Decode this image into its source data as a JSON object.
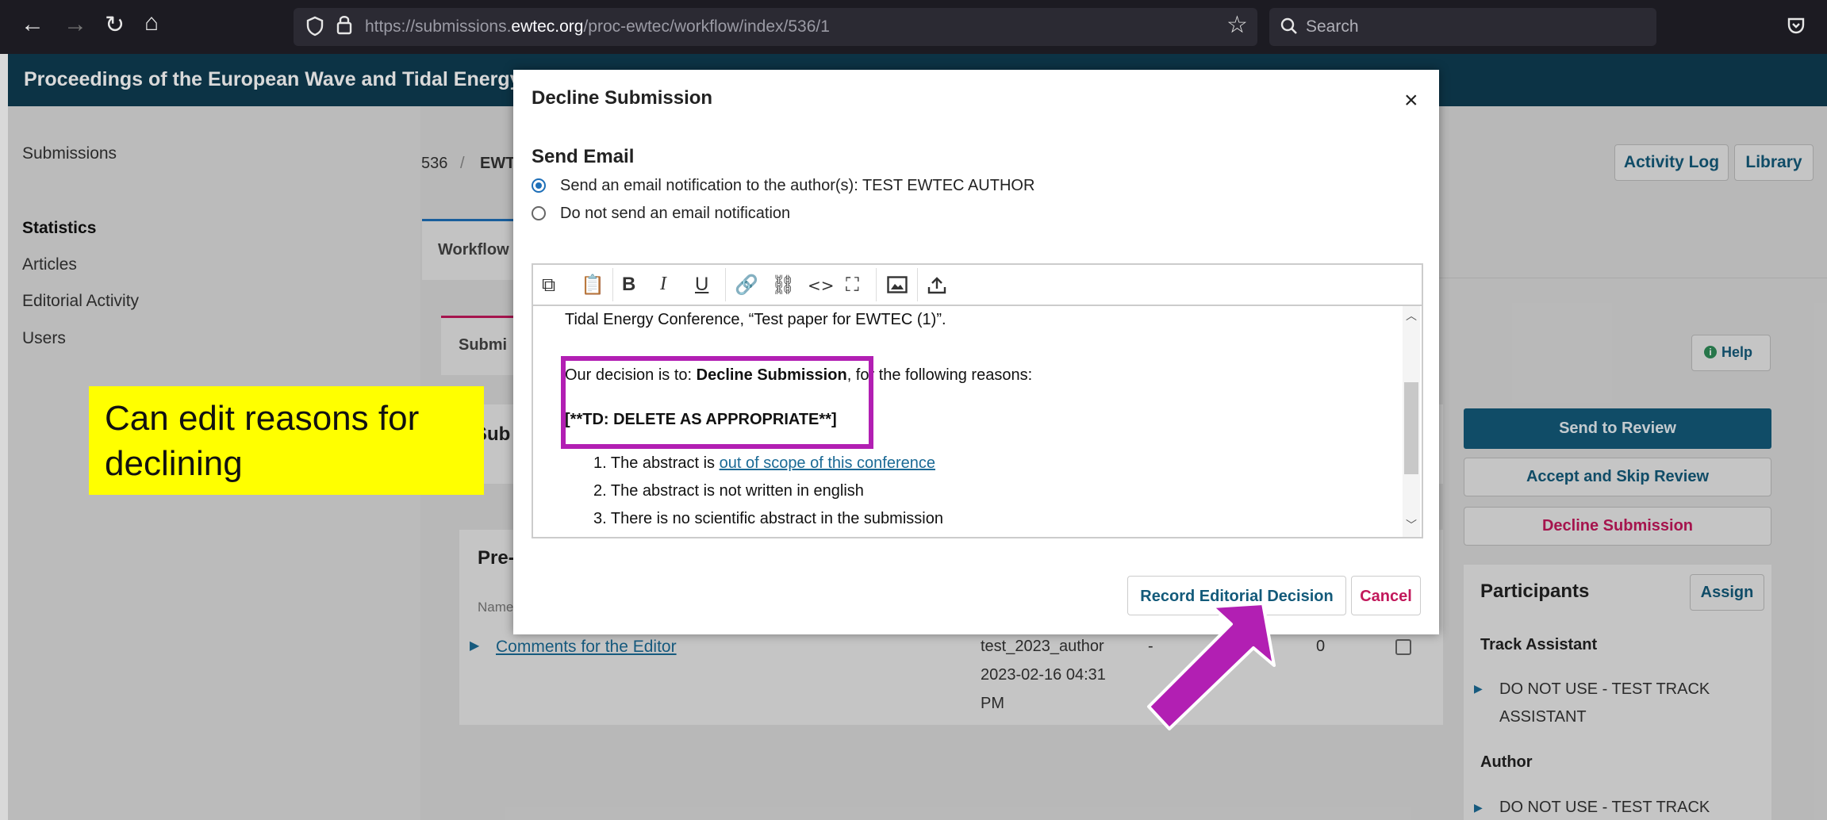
{
  "browser": {
    "url_prefix": "https://submissions.",
    "url_domain": "ewtec.org",
    "url_path": "/proc-ewtec/workflow/index/536/1",
    "search_placeholder": "Search"
  },
  "page": {
    "header_title": "Proceedings of the European Wave and Tidal Energy C",
    "sidebar_items": [
      "Submissions",
      "Statistics",
      "Articles",
      "Editorial Activity",
      "Users"
    ],
    "breadcrumb_id": "536",
    "breadcrumb_sep": "/",
    "breadcrumb_title": "EWT",
    "activity_log": "Activity Log",
    "library": "Library",
    "tab_workflow": "Workflow",
    "subtab_submission": "Submi",
    "help": "Help",
    "section_heading": "Sub",
    "files_heading": "Pre-",
    "files_col_name": "Name",
    "file_row": {
      "link": "Comments for the Editor",
      "author": "test_2023_author",
      "date": "2023-02-16 04:31",
      "time": "PM",
      "dash": "-",
      "count": "0"
    },
    "actions": {
      "send_to_review": "Send to Review",
      "accept_skip": "Accept and Skip Review",
      "decline": "Decline Submission"
    },
    "participants": {
      "title": "Participants",
      "assign": "Assign",
      "track_assistant_label": "Track Assistant",
      "track_assistant_name_1": "DO NOT USE - TEST TRACK",
      "track_assistant_name_2": "ASSISTANT",
      "author_label": "Author",
      "author_name_1": "DO NOT USE - TEST TRACK"
    }
  },
  "modal": {
    "title": "Decline Submission",
    "close": "×",
    "send_email_heading": "Send Email",
    "radio_send": "Send an email notification to the author(s): TEST EWTEC AUTHOR",
    "radio_nosend": "Do not send an email notification",
    "editor": {
      "line_top": "Tidal Energy Conference, “Test paper for EWTEC (1)”.",
      "decision_prefix": "Our decision is to: ",
      "decision_bold": "Decline Submission",
      "decision_suffix": ", for the following reasons:",
      "td_note": "[**TD: DELETE AS APPROPRIATE**]",
      "reason_1_prefix": "1. The abstract is ",
      "reason_1_link": "out of scope of this conference",
      "reason_2": "2. The abstract is not written in english",
      "reason_3": "3. There is no scientific abstract in the submission"
    },
    "record_button": "Record Editorial Decision",
    "cancel_button": "Cancel"
  },
  "annotation": {
    "callout_text": "Can edit reasons for declining"
  },
  "colors": {
    "header_bg": "#0f3c52",
    "primary_button": "#135a7a",
    "decline_red": "#c2185b",
    "annotation_magenta": "#b21fb3",
    "callout_yellow": "#ffff00"
  }
}
